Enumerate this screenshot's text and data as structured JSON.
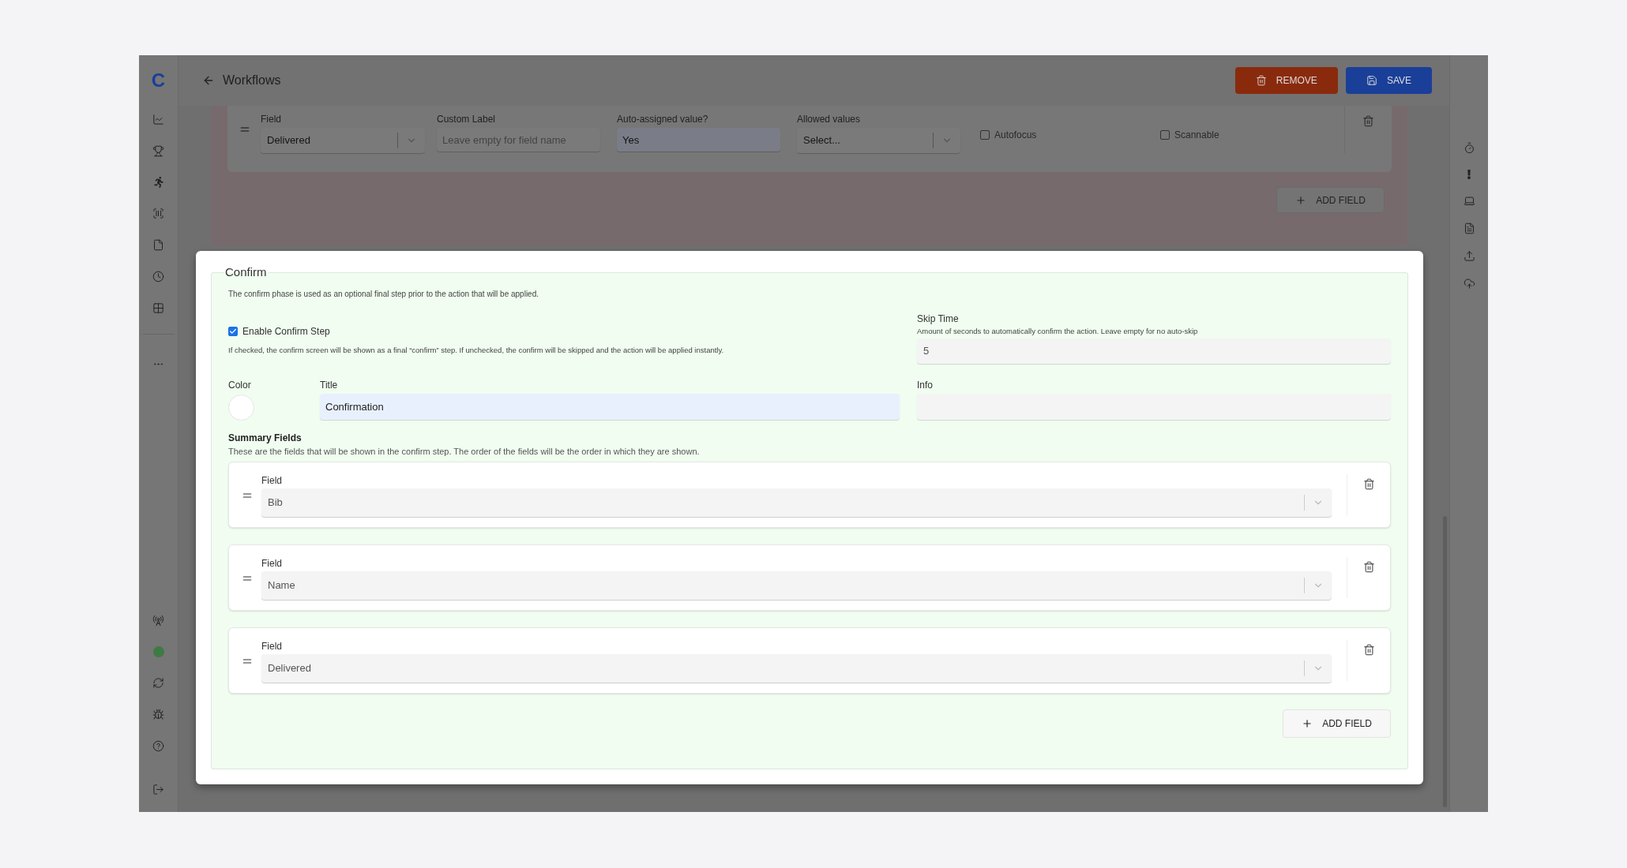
{
  "sidebar": {
    "logo": "C"
  },
  "header": {
    "back_label": "Workflows",
    "buttons": [
      {
        "label": "REMOVE",
        "kind": "danger"
      },
      {
        "label": "SAVE",
        "kind": "primary"
      }
    ]
  },
  "previous_phase": {
    "field": {
      "label": "Field",
      "value": "Delivered"
    },
    "custom_label": {
      "label": "Custom Label",
      "placeholder": "Leave empty for field name"
    },
    "auto_value": {
      "label": "Auto-assigned value?",
      "value": "Yes"
    },
    "allowed_values": {
      "label": "Allowed values",
      "placeholder": "Select..."
    },
    "checkboxes": [
      {
        "label": "Autofocus",
        "checked": false
      },
      {
        "label": "Scannable",
        "checked": false
      }
    ],
    "add_button": "ADD FIELD"
  },
  "confirm": {
    "legend": "Confirm",
    "description": "The confirm phase is used as an optional final step prior to the action that will be applied.",
    "enable": {
      "label": "Enable Confirm Step",
      "checked": true,
      "hint": "If checked, the confirm screen will be shown as a final “confirm” step. If unchecked, the confirm will be skipped and the action will be applied instantly."
    },
    "skip_time": {
      "label": "Skip Time",
      "hint": "Amount of seconds to automatically confirm the action. Leave empty for no auto-skip",
      "value": "5"
    },
    "color": {
      "label": "Color"
    },
    "title": {
      "label": "Title",
      "value": "Confirmation"
    },
    "info": {
      "label": "Info"
    },
    "summary": {
      "title": "Summary Fields",
      "description": "These are the fields that will be shown in the confirm step. The order of the fields will be the order in which they are shown.",
      "fields": [
        {
          "label": "Field",
          "value": "Bib"
        },
        {
          "label": "Field",
          "value": "Name"
        },
        {
          "label": "Field",
          "value": "Delivered"
        }
      ],
      "add_button": "ADD FIELD"
    }
  }
}
